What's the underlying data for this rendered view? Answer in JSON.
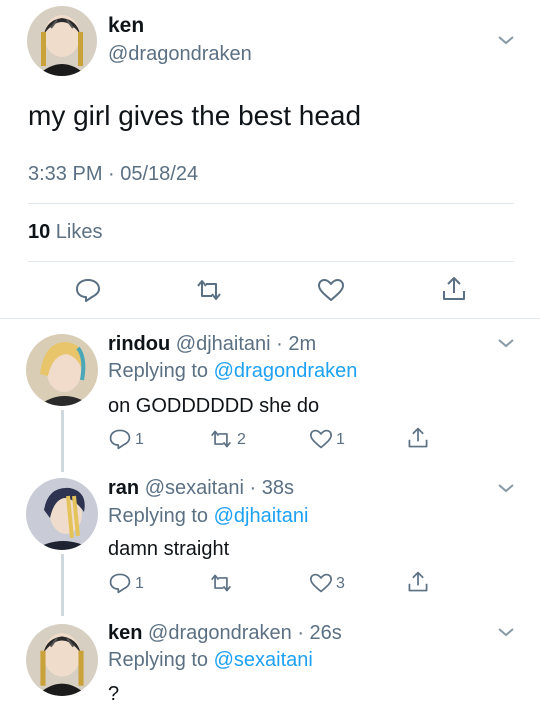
{
  "main": {
    "name": "ken",
    "handle": "@dragondraken",
    "text": "my girl gives the best head",
    "timestamp": "3:33 PM · 05/18/24",
    "likes_count": "10",
    "likes_label": " Likes"
  },
  "replies": [
    {
      "name": "rindou",
      "meta": "@djhaitani · 2m",
      "replying_label": "Replying to ",
      "replying_to": "@dragondraken",
      "text": "on GODDDDDD she do",
      "reply_count": "1",
      "retweet_count": "2",
      "like_count": "1"
    },
    {
      "name": "ran",
      "meta": "@sexaitani · 38s",
      "replying_label": "Replying to ",
      "replying_to": "@djhaitani",
      "text": "damn straight",
      "reply_count": "1",
      "retweet_count": "",
      "like_count": "3"
    },
    {
      "name": "ken",
      "meta": "@dragondraken · 26s",
      "replying_label": "Replying to ",
      "replying_to": "@sexaitani",
      "text": "?"
    }
  ],
  "colors": {
    "text": "#0f1419",
    "secondary": "#5b7083",
    "link": "#1da1f2",
    "divider": "#e1e8ed"
  }
}
